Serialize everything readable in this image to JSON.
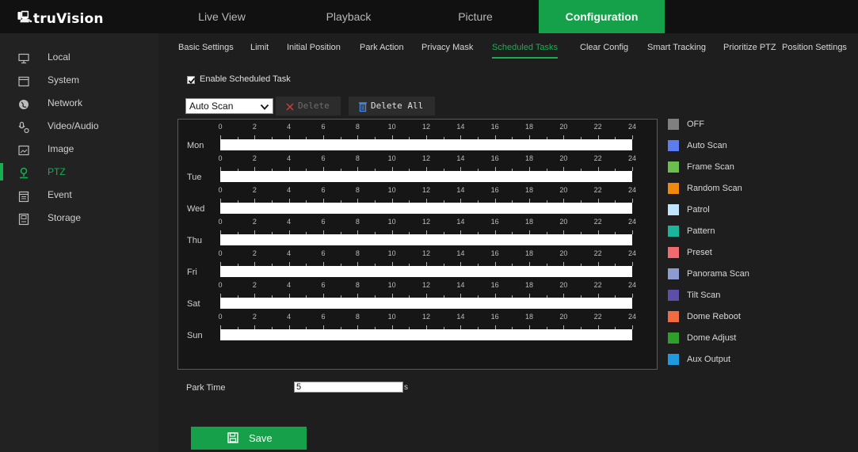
{
  "app": {
    "logo_text": "truVision"
  },
  "main_tabs": [
    {
      "label": "Live View",
      "active": false
    },
    {
      "label": "Playback",
      "active": false
    },
    {
      "label": "Picture",
      "active": false
    },
    {
      "label": "Configuration",
      "active": true
    }
  ],
  "sidebar": {
    "items": [
      {
        "label": "Local",
        "icon": "monitor-icon",
        "active": false
      },
      {
        "label": "System",
        "icon": "system-icon",
        "active": false
      },
      {
        "label": "Network",
        "icon": "globe-icon",
        "active": false
      },
      {
        "label": "Video/Audio",
        "icon": "video-audio-icon",
        "active": false
      },
      {
        "label": "Image",
        "icon": "image-icon",
        "active": false
      },
      {
        "label": "PTZ",
        "icon": "ptz-icon",
        "active": true
      },
      {
        "label": "Event",
        "icon": "event-icon",
        "active": false
      },
      {
        "label": "Storage",
        "icon": "storage-icon",
        "active": false
      }
    ]
  },
  "sub_tabs": [
    {
      "label": "Basic Settings",
      "active": false
    },
    {
      "label": "Limit",
      "active": false
    },
    {
      "label": "Initial Position",
      "active": false
    },
    {
      "label": "Park Action",
      "active": false
    },
    {
      "label": "Privacy Mask",
      "active": false
    },
    {
      "label": "Scheduled Tasks",
      "active": true
    },
    {
      "label": "Clear Config",
      "active": false
    },
    {
      "label": "Smart Tracking",
      "active": false
    },
    {
      "label": "Prioritize PTZ",
      "active": false
    },
    {
      "label": "Position Settings",
      "active": false
    }
  ],
  "scheduled": {
    "enable_label": "Enable Scheduled Task",
    "enable_checked": true,
    "mode_value": "Auto Scan",
    "delete_label": "Delete",
    "delete_all_label": "Delete All",
    "hour_labels": [
      "0",
      "2",
      "4",
      "6",
      "8",
      "10",
      "12",
      "14",
      "16",
      "18",
      "20",
      "22",
      "24"
    ],
    "days": [
      "Mon",
      "Tue",
      "Wed",
      "Thu",
      "Fri",
      "Sat",
      "Sun"
    ]
  },
  "legend": [
    {
      "label": "OFF",
      "color": "#808080"
    },
    {
      "label": "Auto Scan",
      "color": "#5b7df0"
    },
    {
      "label": "Frame Scan",
      "color": "#6bbf4e"
    },
    {
      "label": "Random Scan",
      "color": "#f08a0c"
    },
    {
      "label": "Patrol",
      "color": "#bfe4fb"
    },
    {
      "label": "Pattern",
      "color": "#1ab59a"
    },
    {
      "label": "Preset",
      "color": "#f06a6e"
    },
    {
      "label": "Panorama Scan",
      "color": "#8d9cd0"
    },
    {
      "label": "Tilt Scan",
      "color": "#5d4fa8"
    },
    {
      "label": "Dome Reboot",
      "color": "#f06a42"
    },
    {
      "label": "Dome Adjust",
      "color": "#2ea02a"
    },
    {
      "label": "Aux Output",
      "color": "#1e9be0"
    }
  ],
  "park_time": {
    "label": "Park Time",
    "value": "5",
    "unit": "s"
  },
  "save": {
    "label": "Save"
  },
  "colors": {
    "accent": "#17a04a",
    "background": "#1e1e1e",
    "topbar": "#111111"
  }
}
